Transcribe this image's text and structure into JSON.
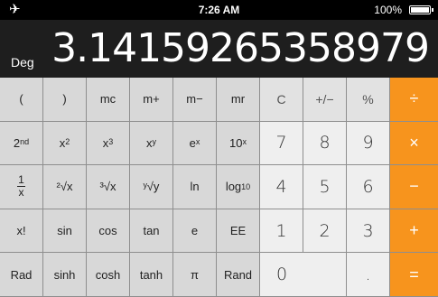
{
  "status_bar": {
    "airplane_icon": "airplane-icon",
    "time": "7:26 AM",
    "battery_percent": "100%"
  },
  "display": {
    "mode": "Deg",
    "value": "3.14159265358979"
  },
  "keys": {
    "row1": {
      "open_paren": "(",
      "close_paren": ")",
      "mc": "mc",
      "m_plus": "m+",
      "m_minus": "m−",
      "mr": "mr",
      "clear": "C",
      "sign": "+/−",
      "percent": "%",
      "divide": "÷"
    },
    "row2": {
      "second": "2",
      "second_sup": "nd",
      "x_sq": "x",
      "x_sq_sup": "2",
      "x_cube": "x",
      "x_cube_sup": "3",
      "x_pow_y": "x",
      "x_pow_y_sup": "y",
      "e_pow_x": "e",
      "e_pow_x_sup": "x",
      "ten_pow_x": "10",
      "ten_pow_x_sup": "x",
      "seven": "7",
      "eight": "8",
      "nine": "9",
      "multiply": "×"
    },
    "row3": {
      "recip_num": "1",
      "recip_den": "x",
      "sqrt2": "²√x",
      "sqrt3": "³√x",
      "sqrty": "ʸ√y",
      "ln": "ln",
      "log10": "log",
      "log10_sub": "10",
      "four": "4",
      "five": "5",
      "six": "6",
      "minus": "−"
    },
    "row4": {
      "factorial": "x!",
      "sin": "sin",
      "cos": "cos",
      "tan": "tan",
      "e": "e",
      "ee": "EE",
      "one": "1",
      "two": "2",
      "three": "3",
      "plus": "+"
    },
    "row5": {
      "rad": "Rad",
      "sinh": "sinh",
      "cosh": "cosh",
      "tanh": "tanh",
      "pi": "π",
      "rand": "Rand",
      "zero": "0",
      "decimal": ".",
      "equals": "="
    }
  },
  "colors": {
    "operator": "#f7941d",
    "display_bg": "#1e1e1e",
    "status_bg": "#000000"
  }
}
